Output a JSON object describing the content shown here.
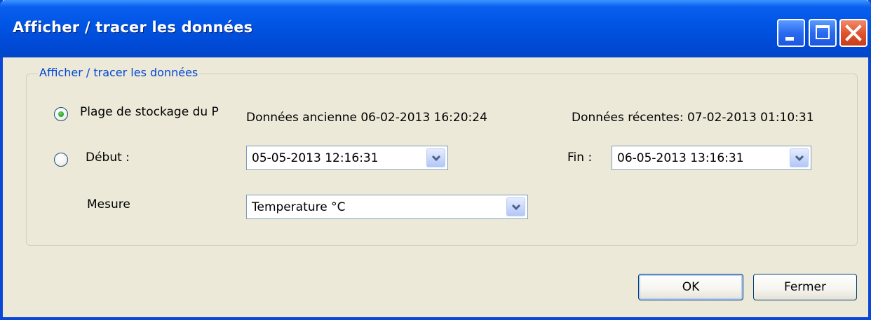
{
  "window": {
    "title": "Afficher / tracer les données"
  },
  "group": {
    "legend": "Afficher / tracer les données"
  },
  "storage_option": {
    "label": "Plage de stockage du P",
    "selected": true,
    "oldest_data": "Données ancienne 06-02-2013 16:20:24",
    "recent_data": "Données récentes: 07-02-2013 01:10:31"
  },
  "range_option": {
    "label": "Début :",
    "selected": false,
    "start_value": "05-05-2013 12:16:31",
    "end_label": "Fin :",
    "end_value": "06-05-2013 13:16:31"
  },
  "measure": {
    "label": "Mesure",
    "value": "Temperature °C"
  },
  "buttons": {
    "ok": "OK",
    "close": "Fermer"
  },
  "icons": {
    "minimize": "minimize-icon",
    "maximize": "maximize-icon",
    "close": "close-icon",
    "dropdown": "chevron-down-icon"
  }
}
